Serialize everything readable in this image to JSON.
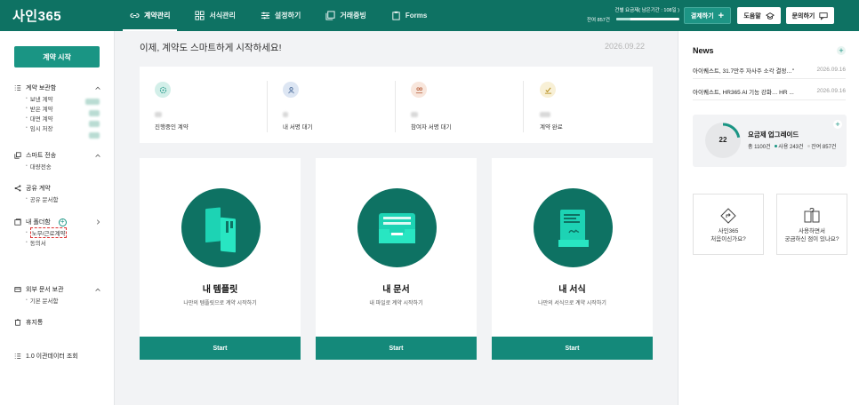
{
  "header": {
    "logo": "사인365",
    "nav": [
      {
        "label": "계약관리",
        "icon": "link-icon"
      },
      {
        "label": "서식관리",
        "icon": "grid-icon"
      },
      {
        "label": "설정하기",
        "icon": "sliders-icon"
      },
      {
        "label": "거래증빙",
        "icon": "copy-icon"
      },
      {
        "label": "Forms",
        "icon": "clipboard-icon"
      }
    ],
    "plan_line1": "건별 요금제( 남은기간 : 108일 )",
    "plan_line2": "잔여 857건",
    "plan_fraction": 0.221,
    "pay_label": "결제하기",
    "help_label": "도움말",
    "inquiry_label": "문의하기"
  },
  "sidebar": {
    "start_label": "계약 시작",
    "sections": [
      {
        "label": "계약 보관함",
        "items": [
          "보낸 계약",
          "받은 계약",
          "대면 계약",
          "임시 저장"
        ]
      },
      {
        "label": "스마트 전송",
        "items": [
          "대량전송"
        ]
      },
      {
        "label": "공유 계약",
        "items": [
          "공유 문서함"
        ]
      },
      {
        "label": "내 폴더함",
        "items": [
          "노무/근로계약",
          "동의서"
        ]
      },
      {
        "label": "외부 문서 보관",
        "items": [
          "기본 문서함"
        ]
      }
    ],
    "trash_label": "휴지통",
    "legacy_label": "1.0 이관데이터 조회"
  },
  "main": {
    "welcome": "이제, 계약도 스마트하게 시작하세요!",
    "date": "2026.09.22",
    "stats": [
      {
        "label": "진행중인 계약",
        "color": "#d3efe9",
        "icon": "progress-icon"
      },
      {
        "label": "내 서명 대기",
        "color": "#dde6f3",
        "icon": "person-icon"
      },
      {
        "label": "참여자 서명 대기",
        "color": "#f8e6dc",
        "icon": "people-icon"
      },
      {
        "label": "계약 완료",
        "color": "#f8f0d6",
        "icon": "check-icon"
      }
    ],
    "cards": [
      {
        "title": "내 템플릿",
        "desc": "나만의 템플릿으로 계약 시작하기",
        "button": "Start",
        "icon": "template-icon"
      },
      {
        "title": "내 문서",
        "desc": "내 파일로 계약 시작하기",
        "button": "Start",
        "icon": "inbox-icon"
      },
      {
        "title": "내 서식",
        "desc": "나만의 서식으로 계약 시작하기",
        "button": "Start",
        "icon": "form-icon"
      }
    ]
  },
  "right": {
    "news_title": "News",
    "news": [
      {
        "title": "아이퀘스트, 31.7만주 자사주 소각 결정…\"",
        "date": "2026.09.16"
      },
      {
        "title": "아이퀘스트, HR365 AI 기능 강화… HR ...",
        "date": "2026.09.16"
      }
    ],
    "upgrade": {
      "count": "22",
      "title": "요금제 업그레이드",
      "total": "총 1100건",
      "used": "사용 243건",
      "remain": "잔여 857건",
      "used_fraction": 0.221
    },
    "faq": [
      {
        "line1": "사인365",
        "line2": "처음이신가요?",
        "icon": "signpost-icon"
      },
      {
        "line1": "사용하면서",
        "line2": "궁금하신 점이 있나요?",
        "icon": "book-question-icon"
      }
    ],
    "accent": "#0e7263"
  }
}
